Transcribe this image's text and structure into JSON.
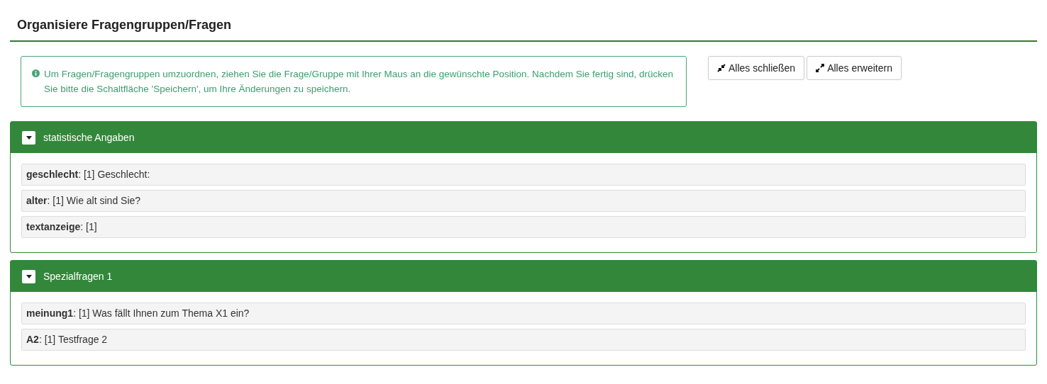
{
  "title": "Organisiere Fragengruppen/Fragen",
  "info": "Um Fragen/Fragengruppen umzuordnen, ziehen Sie die Frage/Gruppe mit Ihrer Maus an die gewünschte Position. Nachdem Sie fertig sind, drücken Sie bitte die Schaltfläche 'Speichern', um Ihre Änderungen zu speichern.",
  "buttons": [
    {
      "kind": "collapse",
      "label": "Alles schließen"
    },
    {
      "kind": "expand",
      "label": "Alles erweitern"
    }
  ],
  "groups": [
    {
      "name": "statistische Angaben",
      "expanded": true,
      "questions": [
        "**geschlecht**: [1] Geschlecht:",
        "**alter**: [1] Wie alt sind Sie?",
        "**textanzeige**: [1]"
      ]
    },
    {
      "name": "Spezialfragen 1",
      "expanded": true,
      "questions": [
        "**meinung1**: [1] Was fällt Ihnen zum Thema X1 ein?",
        "**A2**: [1] Testfrage 2"
      ]
    }
  ]
}
